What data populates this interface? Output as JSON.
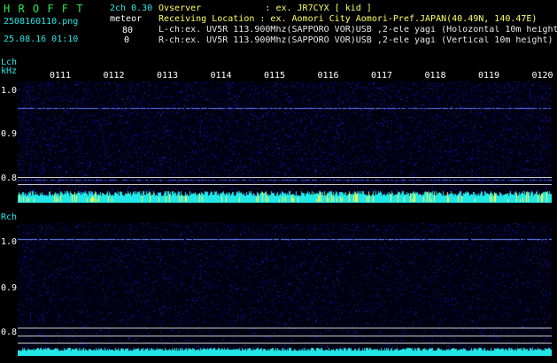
{
  "header": {
    "logo": "H R O F F T",
    "version": "2ch 0.30",
    "filename": "2508160110.png",
    "mode": "meteor",
    "count_l": "80",
    "count_r": "0",
    "datetime": "25.08.16 01:10",
    "observer_label": "Ovserver            : ex. JR7CYX [ kid ]",
    "location_label": "Receiving Location : ex. Aomori City Aomori-Pref.JAPAN(40.49N, 140.47E)",
    "lch_info": "L-ch:ex. UV5R 113.900Mhz(SAPPORO VOR)USB ,2-ele yagi (Holozontal 10m height",
    "rch_info": "R-ch:ex. UV5R 113.900Mhz(SAPPORO VOR)USB ,2-ele yagi (Vertical 10m height)"
  },
  "lch": {
    "label": "Lch",
    "unit": "kHz",
    "yticks": [
      "1.0",
      "0.9",
      "0.8"
    ]
  },
  "rch": {
    "label": "Rch",
    "yticks": [
      "1.0",
      "0.9",
      "0.8"
    ]
  },
  "time_ticks": [
    "0111",
    "0112",
    "0113",
    "0114",
    "0115",
    "0116",
    "0117",
    "0118",
    "0119",
    "0120"
  ],
  "colors": {
    "background": "#000000",
    "noise": "#1a1aa0",
    "trace": "#3a5aff",
    "cyan": "#22e8e8",
    "yellow": "#ffff44",
    "green": "#22e84a"
  }
}
